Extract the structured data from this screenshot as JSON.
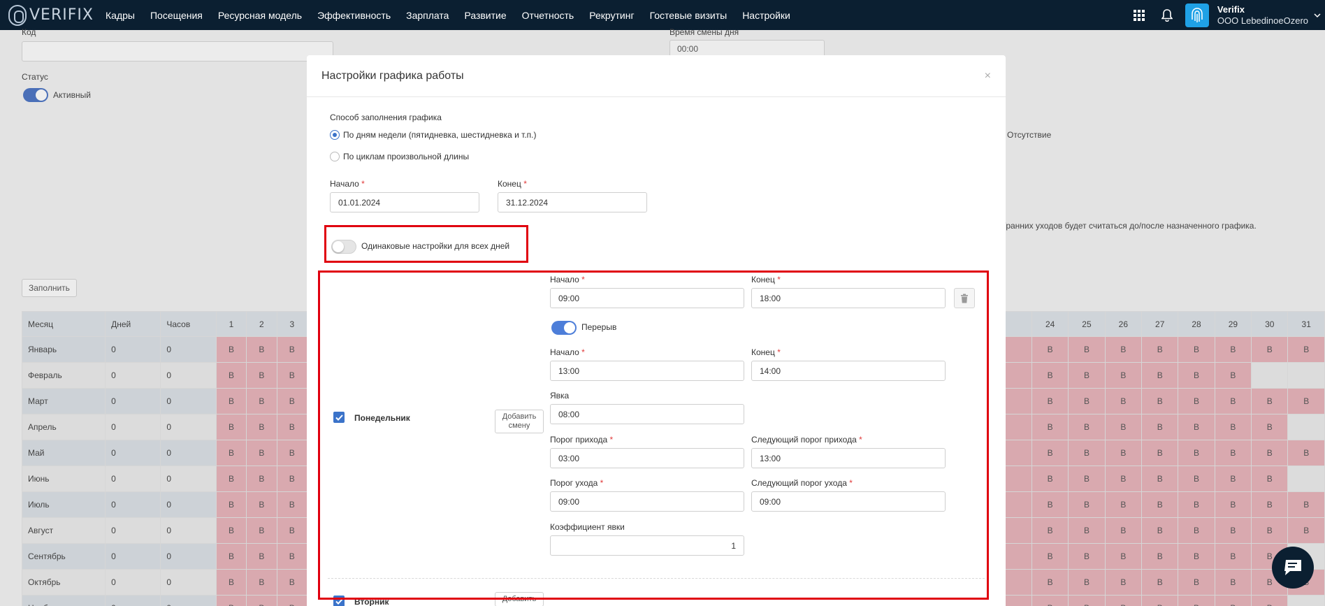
{
  "app": {
    "logo_text": "VERIFIX"
  },
  "nav": [
    "Кадры",
    "Посещения",
    "Ресурсная модель",
    "Эффективность",
    "Зарплата",
    "Развитие",
    "Отчетность",
    "Рекрутинг",
    "Гостевые визиты",
    "Настройки"
  ],
  "user": {
    "name": "Verifix",
    "org": "OOO LebedinoeOzero"
  },
  "background": {
    "code_label": "Код",
    "shift_time_label": "Время смены дня",
    "shift_time_value": "00:00",
    "status_label": "Статус",
    "status_value": "Активный",
    "absence_label": "Отсутствие",
    "late_note": "/ранних уходов будет считаться до/после назначенного графика.",
    "fill_button": "Заполнить",
    "table": {
      "headers_left": [
        "Месяц",
        "Дней",
        "Часов"
      ],
      "days_left": [
        "1",
        "2",
        "3"
      ],
      "days_right": [
        "24",
        "25",
        "26",
        "27",
        "28",
        "29",
        "30",
        "31"
      ],
      "cell_symbol": "В",
      "rows": [
        {
          "month": "Январь",
          "days": "0",
          "hours": "0",
          "right_filled": 8
        },
        {
          "month": "Февраль",
          "days": "0",
          "hours": "0",
          "right_filled": 6
        },
        {
          "month": "Март",
          "days": "0",
          "hours": "0",
          "right_filled": 8
        },
        {
          "month": "Апрель",
          "days": "0",
          "hours": "0",
          "right_filled": 7
        },
        {
          "month": "Май",
          "days": "0",
          "hours": "0",
          "right_filled": 8
        },
        {
          "month": "Июнь",
          "days": "0",
          "hours": "0",
          "right_filled": 7
        },
        {
          "month": "Июль",
          "days": "0",
          "hours": "0",
          "right_filled": 8
        },
        {
          "month": "Август",
          "days": "0",
          "hours": "0",
          "right_filled": 8
        },
        {
          "month": "Сентябрь",
          "days": "0",
          "hours": "0",
          "right_filled": 7
        },
        {
          "month": "Октябрь",
          "days": "0",
          "hours": "0",
          "right_filled": 8
        },
        {
          "month": "Ноябрь",
          "days": "0",
          "hours": "0",
          "right_filled": 7
        }
      ]
    }
  },
  "modal": {
    "title": "Настройки графика работы",
    "close": "×",
    "fill_method_label": "Способ заполнения графика",
    "radio_weekdays": "По дням недели (пятидневка, шестидневка и т.п.)",
    "radio_cycles": "По циклам произвольной длины",
    "start_label": "Начало",
    "end_label": "Конец",
    "start_date": "01.01.2024",
    "end_date": "31.12.2024",
    "same_settings_label": "Одинаковые настройки для всех дней",
    "monday": {
      "label": "Понедельник",
      "add_shift": "Добавить смену",
      "start_label": "Начало",
      "end_label": "Конец",
      "start": "09:00",
      "end": "18:00",
      "break_label": "Перерыв",
      "break_start_label": "Начало",
      "break_end_label": "Конец",
      "break_start": "13:00",
      "break_end": "14:00",
      "attendance_label": "Явка",
      "attendance": "08:00",
      "arrival_threshold_label": "Порог прихода",
      "arrival_threshold": "03:00",
      "next_arrival_threshold_label": "Следующий порог прихода",
      "next_arrival_threshold": "13:00",
      "leave_threshold_label": "Порог ухода",
      "leave_threshold": "09:00",
      "next_leave_threshold_label": "Следующий порог ухода",
      "next_leave_threshold": "09:00",
      "coef_label": "Коэффициент явки",
      "coef": "1"
    },
    "tuesday": {
      "label": "Вторник",
      "add_shift": "Добавить"
    }
  },
  "colors": {
    "topbar": "#0b1f31",
    "accent": "#3b73c9",
    "highlight": "#e0000f",
    "weekend_cell": "#d9a9af"
  }
}
